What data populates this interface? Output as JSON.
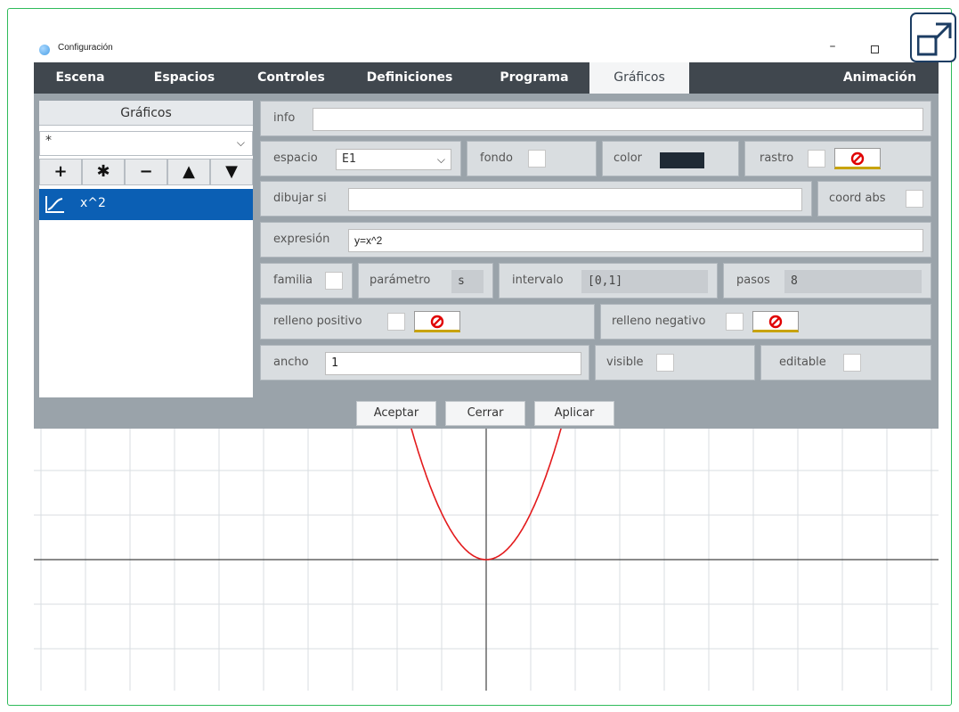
{
  "window": {
    "title": "Configuración"
  },
  "tabs": [
    "Escena",
    "Espacios",
    "Controles",
    "Definiciones",
    "Programa",
    "Gráficos",
    "Animación"
  ],
  "active_tab": "Gráficos",
  "left_panel": {
    "header": "Gráficos",
    "select_value": "*",
    "buttons": [
      "+",
      "✱",
      "−",
      "▲",
      "▼"
    ],
    "items": [
      {
        "label": "x^2",
        "icon": "curve-icon"
      }
    ]
  },
  "fields": {
    "info": {
      "label": "info",
      "value": ""
    },
    "espacio": {
      "label": "espacio",
      "value": "E1"
    },
    "fondo": {
      "label": "fondo"
    },
    "color": {
      "label": "color",
      "value": "#1f2a35"
    },
    "rastro": {
      "label": "rastro"
    },
    "dibujar_si": {
      "label": "dibujar si",
      "value": ""
    },
    "coord_abs": {
      "label": "coord abs"
    },
    "expresion": {
      "label": "expresión",
      "value": "y=x^2"
    },
    "familia": {
      "label": "familia"
    },
    "parametro": {
      "label": "parámetro",
      "value": "s"
    },
    "intervalo": {
      "label": "intervalo",
      "value": "[0,1]"
    },
    "pasos": {
      "label": "pasos",
      "value": "8"
    },
    "relleno_positivo": {
      "label": "relleno positivo"
    },
    "relleno_negativo": {
      "label": "relleno negativo"
    },
    "ancho": {
      "label": "ancho",
      "value": "1"
    },
    "visible": {
      "label": "visible"
    },
    "editable": {
      "label": "editable"
    }
  },
  "actions": [
    "Aceptar",
    "Cerrar",
    "Aplicar"
  ],
  "graph": {
    "expression": "y=x^2",
    "curve_color": "#e31a1c",
    "grid_color": "#d9dde2",
    "axis_color": "#444444"
  },
  "colors": {
    "menubar": "#40474e",
    "panel": "#9aa3aa",
    "selection": "#0b5fb4",
    "frame": "#2fbb5a",
    "no_fill_icon": "#e00000"
  }
}
